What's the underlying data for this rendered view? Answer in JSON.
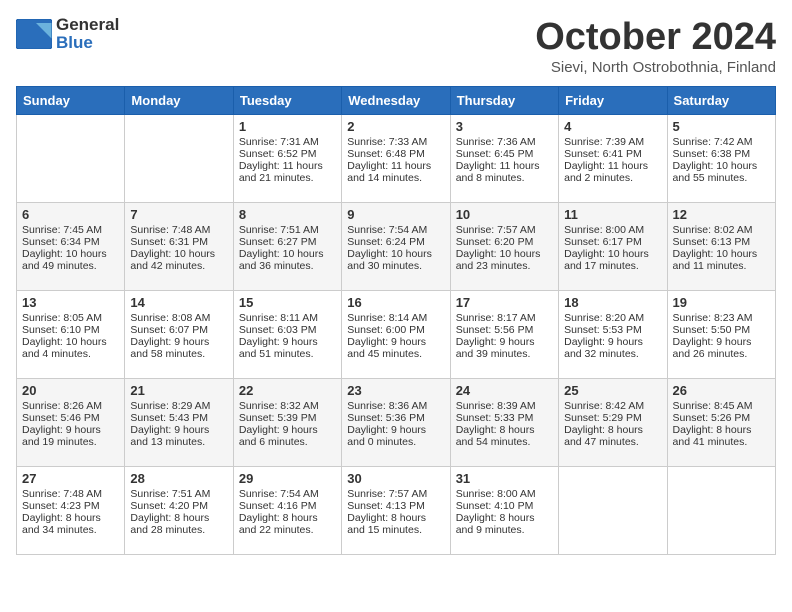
{
  "header": {
    "logo_general": "General",
    "logo_blue": "Blue",
    "month_title": "October 2024",
    "location": "Sievi, North Ostrobothnia, Finland"
  },
  "days_of_week": [
    "Sunday",
    "Monday",
    "Tuesday",
    "Wednesday",
    "Thursday",
    "Friday",
    "Saturday"
  ],
  "weeks": [
    [
      {
        "day": null,
        "content": null
      },
      {
        "day": null,
        "content": null
      },
      {
        "day": "1",
        "sunrise": "Sunrise: 7:31 AM",
        "sunset": "Sunset: 6:52 PM",
        "daylight": "Daylight: 11 hours and 21 minutes."
      },
      {
        "day": "2",
        "sunrise": "Sunrise: 7:33 AM",
        "sunset": "Sunset: 6:48 PM",
        "daylight": "Daylight: 11 hours and 14 minutes."
      },
      {
        "day": "3",
        "sunrise": "Sunrise: 7:36 AM",
        "sunset": "Sunset: 6:45 PM",
        "daylight": "Daylight: 11 hours and 8 minutes."
      },
      {
        "day": "4",
        "sunrise": "Sunrise: 7:39 AM",
        "sunset": "Sunset: 6:41 PM",
        "daylight": "Daylight: 11 hours and 2 minutes."
      },
      {
        "day": "5",
        "sunrise": "Sunrise: 7:42 AM",
        "sunset": "Sunset: 6:38 PM",
        "daylight": "Daylight: 10 hours and 55 minutes."
      }
    ],
    [
      {
        "day": "6",
        "sunrise": "Sunrise: 7:45 AM",
        "sunset": "Sunset: 6:34 PM",
        "daylight": "Daylight: 10 hours and 49 minutes."
      },
      {
        "day": "7",
        "sunrise": "Sunrise: 7:48 AM",
        "sunset": "Sunset: 6:31 PM",
        "daylight": "Daylight: 10 hours and 42 minutes."
      },
      {
        "day": "8",
        "sunrise": "Sunrise: 7:51 AM",
        "sunset": "Sunset: 6:27 PM",
        "daylight": "Daylight: 10 hours and 36 minutes."
      },
      {
        "day": "9",
        "sunrise": "Sunrise: 7:54 AM",
        "sunset": "Sunset: 6:24 PM",
        "daylight": "Daylight: 10 hours and 30 minutes."
      },
      {
        "day": "10",
        "sunrise": "Sunrise: 7:57 AM",
        "sunset": "Sunset: 6:20 PM",
        "daylight": "Daylight: 10 hours and 23 minutes."
      },
      {
        "day": "11",
        "sunrise": "Sunrise: 8:00 AM",
        "sunset": "Sunset: 6:17 PM",
        "daylight": "Daylight: 10 hours and 17 minutes."
      },
      {
        "day": "12",
        "sunrise": "Sunrise: 8:02 AM",
        "sunset": "Sunset: 6:13 PM",
        "daylight": "Daylight: 10 hours and 11 minutes."
      }
    ],
    [
      {
        "day": "13",
        "sunrise": "Sunrise: 8:05 AM",
        "sunset": "Sunset: 6:10 PM",
        "daylight": "Daylight: 10 hours and 4 minutes."
      },
      {
        "day": "14",
        "sunrise": "Sunrise: 8:08 AM",
        "sunset": "Sunset: 6:07 PM",
        "daylight": "Daylight: 9 hours and 58 minutes."
      },
      {
        "day": "15",
        "sunrise": "Sunrise: 8:11 AM",
        "sunset": "Sunset: 6:03 PM",
        "daylight": "Daylight: 9 hours and 51 minutes."
      },
      {
        "day": "16",
        "sunrise": "Sunrise: 8:14 AM",
        "sunset": "Sunset: 6:00 PM",
        "daylight": "Daylight: 9 hours and 45 minutes."
      },
      {
        "day": "17",
        "sunrise": "Sunrise: 8:17 AM",
        "sunset": "Sunset: 5:56 PM",
        "daylight": "Daylight: 9 hours and 39 minutes."
      },
      {
        "day": "18",
        "sunrise": "Sunrise: 8:20 AM",
        "sunset": "Sunset: 5:53 PM",
        "daylight": "Daylight: 9 hours and 32 minutes."
      },
      {
        "day": "19",
        "sunrise": "Sunrise: 8:23 AM",
        "sunset": "Sunset: 5:50 PM",
        "daylight": "Daylight: 9 hours and 26 minutes."
      }
    ],
    [
      {
        "day": "20",
        "sunrise": "Sunrise: 8:26 AM",
        "sunset": "Sunset: 5:46 PM",
        "daylight": "Daylight: 9 hours and 19 minutes."
      },
      {
        "day": "21",
        "sunrise": "Sunrise: 8:29 AM",
        "sunset": "Sunset: 5:43 PM",
        "daylight": "Daylight: 9 hours and 13 minutes."
      },
      {
        "day": "22",
        "sunrise": "Sunrise: 8:32 AM",
        "sunset": "Sunset: 5:39 PM",
        "daylight": "Daylight: 9 hours and 6 minutes."
      },
      {
        "day": "23",
        "sunrise": "Sunrise: 8:36 AM",
        "sunset": "Sunset: 5:36 PM",
        "daylight": "Daylight: 9 hours and 0 minutes."
      },
      {
        "day": "24",
        "sunrise": "Sunrise: 8:39 AM",
        "sunset": "Sunset: 5:33 PM",
        "daylight": "Daylight: 8 hours and 54 minutes."
      },
      {
        "day": "25",
        "sunrise": "Sunrise: 8:42 AM",
        "sunset": "Sunset: 5:29 PM",
        "daylight": "Daylight: 8 hours and 47 minutes."
      },
      {
        "day": "26",
        "sunrise": "Sunrise: 8:45 AM",
        "sunset": "Sunset: 5:26 PM",
        "daylight": "Daylight: 8 hours and 41 minutes."
      }
    ],
    [
      {
        "day": "27",
        "sunrise": "Sunrise: 7:48 AM",
        "sunset": "Sunset: 4:23 PM",
        "daylight": "Daylight: 8 hours and 34 minutes."
      },
      {
        "day": "28",
        "sunrise": "Sunrise: 7:51 AM",
        "sunset": "Sunset: 4:20 PM",
        "daylight": "Daylight: 8 hours and 28 minutes."
      },
      {
        "day": "29",
        "sunrise": "Sunrise: 7:54 AM",
        "sunset": "Sunset: 4:16 PM",
        "daylight": "Daylight: 8 hours and 22 minutes."
      },
      {
        "day": "30",
        "sunrise": "Sunrise: 7:57 AM",
        "sunset": "Sunset: 4:13 PM",
        "daylight": "Daylight: 8 hours and 15 minutes."
      },
      {
        "day": "31",
        "sunrise": "Sunrise: 8:00 AM",
        "sunset": "Sunset: 4:10 PM",
        "daylight": "Daylight: 8 hours and 9 minutes."
      },
      {
        "day": null,
        "content": null
      },
      {
        "day": null,
        "content": null
      }
    ]
  ]
}
